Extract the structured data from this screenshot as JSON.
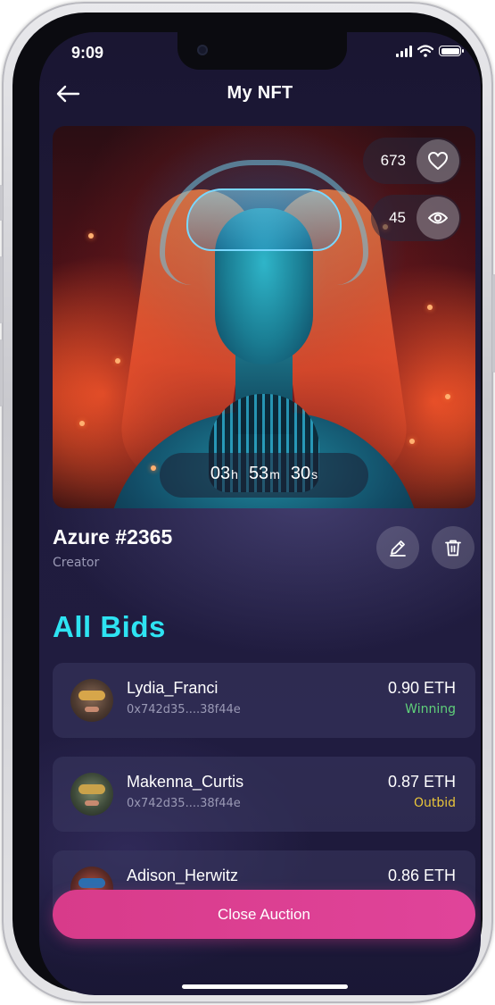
{
  "status_bar": {
    "time": "9:09"
  },
  "header": {
    "title": "My NFT"
  },
  "nft": {
    "likes": "673",
    "views": "45",
    "timer": {
      "hours": "03",
      "hours_unit": "h",
      "minutes": "53",
      "minutes_unit": "m",
      "seconds": "30",
      "seconds_unit": "s"
    },
    "name": "Azure #2365",
    "role": "Creator"
  },
  "bids_section": {
    "title": "All Bids",
    "bids": [
      {
        "user": "Lydia_Franci",
        "address": "0x742d35....38f44e",
        "amount": "0.90 ETH",
        "status": "Winning",
        "status_color": "#5fd07a"
      },
      {
        "user": "Makenna_Curtis",
        "address": "0x742d35....38f44e",
        "amount": "0.87 ETH",
        "status": "Outbid",
        "status_color": "#e9c53a"
      },
      {
        "user": "Adison_Herwitz",
        "amount": "0.86 ETH"
      }
    ]
  },
  "close_button": {
    "label": "Close Auction"
  },
  "icons": [
    "back-arrow-icon",
    "heart-icon",
    "eye-icon",
    "edit-pencil-icon",
    "trash-icon",
    "signal-icon",
    "wifi-icon",
    "battery-icon"
  ],
  "colors": {
    "accent_cyan": "#2ee3f2",
    "button_pink": "#d83b8a",
    "background": "#1f1b3d"
  }
}
